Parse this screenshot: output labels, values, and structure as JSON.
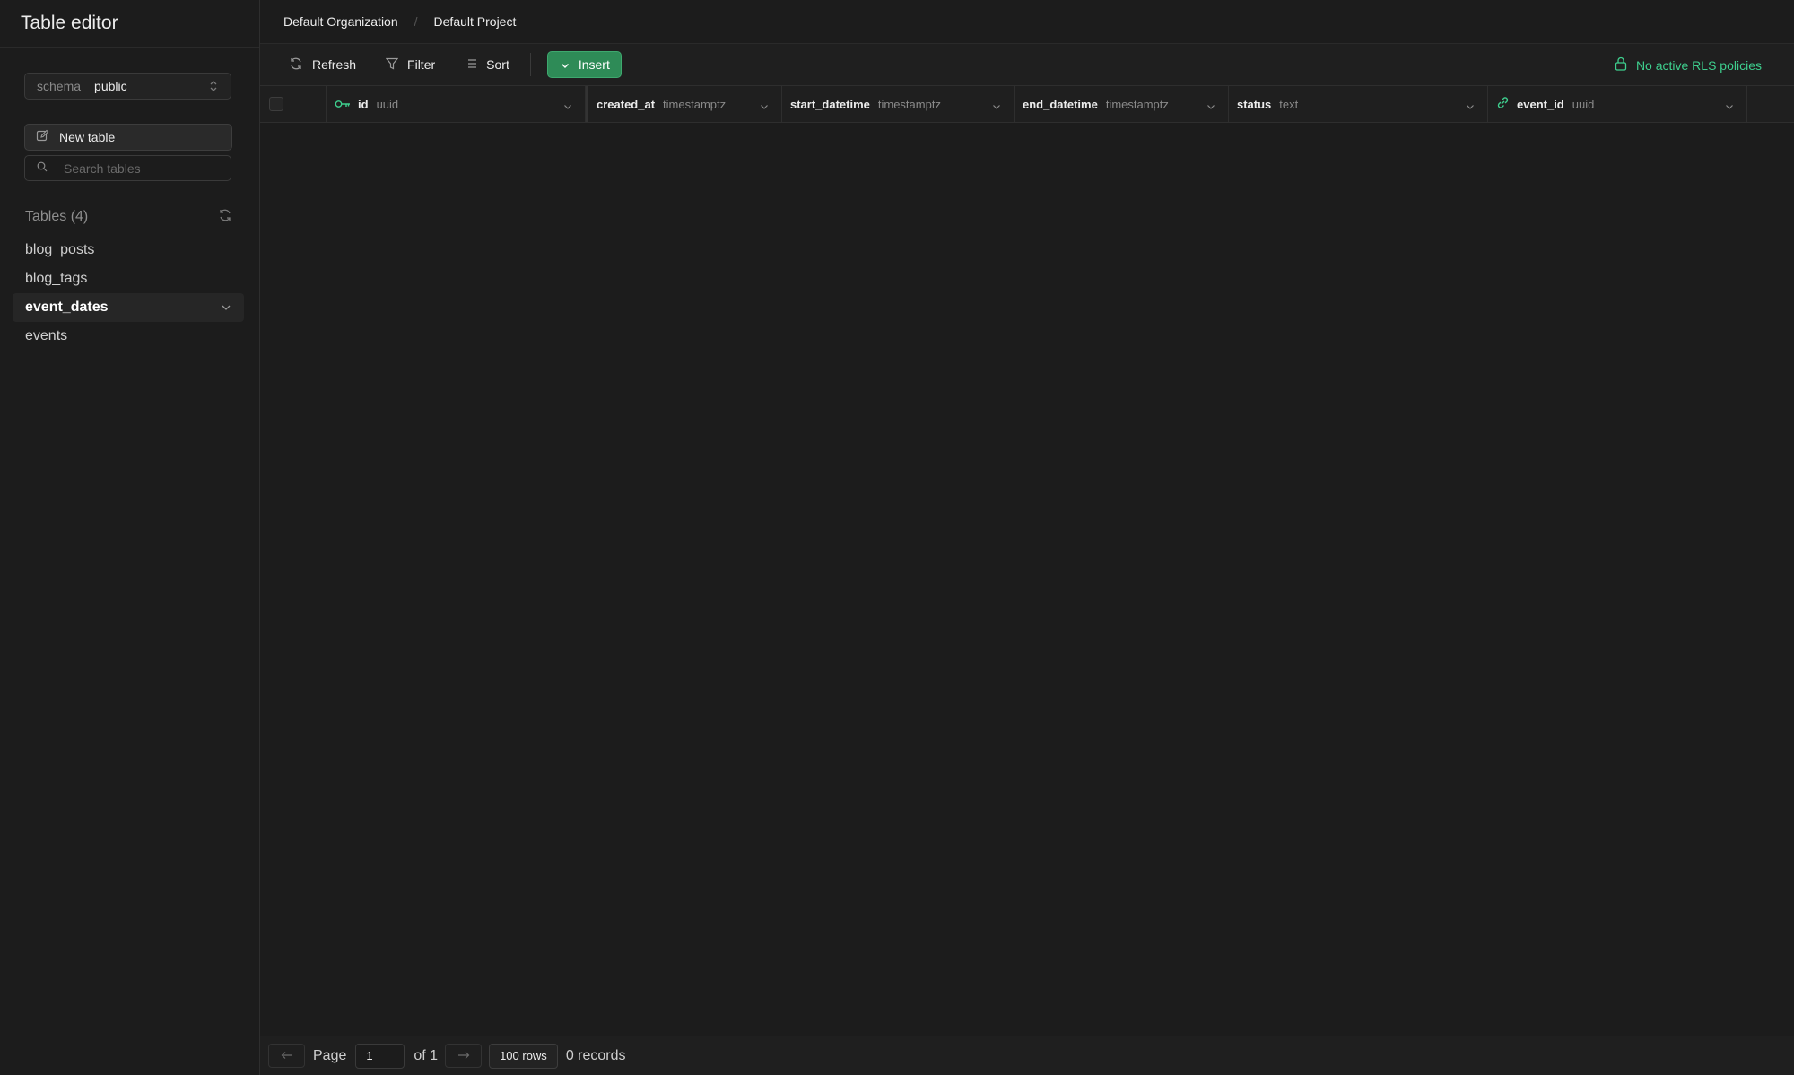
{
  "sidebar": {
    "title": "Table editor",
    "schema": {
      "label": "schema",
      "value": "public"
    },
    "new_table_label": "New table",
    "search_placeholder": "Search tables",
    "tables_header": "Tables (4)",
    "tables": [
      {
        "name": "blog_posts",
        "active": false
      },
      {
        "name": "blog_tags",
        "active": false
      },
      {
        "name": "event_dates",
        "active": true
      },
      {
        "name": "events",
        "active": false
      }
    ]
  },
  "breadcrumb": {
    "org": "Default Organization",
    "separator": "/",
    "project": "Default Project"
  },
  "toolbar": {
    "refresh": "Refresh",
    "filter": "Filter",
    "sort": "Sort",
    "insert": "Insert",
    "rls_status": "No active RLS policies"
  },
  "columns": [
    {
      "name": "id",
      "type": "uuid",
      "icon": "key-icon"
    },
    {
      "name": "created_at",
      "type": "timestamptz",
      "icon": ""
    },
    {
      "name": "start_datetime",
      "type": "timestamptz",
      "icon": ""
    },
    {
      "name": "end_datetime",
      "type": "timestamptz",
      "icon": ""
    },
    {
      "name": "status",
      "type": "text",
      "icon": ""
    },
    {
      "name": "event_id",
      "type": "uuid",
      "icon": "link-icon"
    }
  ],
  "footer": {
    "page_label": "Page",
    "page_value": "1",
    "of_label": "of 1",
    "rows_label": "100 rows",
    "records_label": "0 records"
  },
  "colors": {
    "accent": "#3ecf8e",
    "insert_bg": "#2e8b57",
    "bg": "#1c1c1c"
  }
}
